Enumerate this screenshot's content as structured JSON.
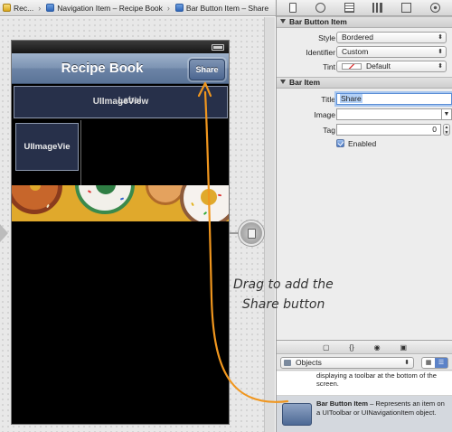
{
  "jumpbar": {
    "crumbs": [
      {
        "label": "Rec..."
      },
      {
        "label": "Navigation Item – Recipe Book"
      },
      {
        "label": "Bar Button Item – Share"
      }
    ]
  },
  "phone": {
    "nav_title": "Recipe Book",
    "share_label": "Share",
    "top_view_label_back": "UIImageView",
    "top_view_label_front": "Label",
    "thumb_view_label": "UIImageVie"
  },
  "inspector": {
    "bar_button_section": "Bar Button Item",
    "style_label": "Style",
    "style_value": "Bordered",
    "identifier_label": "Identifier",
    "identifier_value": "Custom",
    "tint_label": "Tint",
    "tint_value": "Default",
    "bar_item_section": "Bar Item",
    "title_label": "Title",
    "title_value": "Share",
    "image_label": "Image",
    "image_value": "",
    "tag_label": "Tag",
    "tag_value": "0",
    "enabled_label": "Enabled"
  },
  "library": {
    "filter_value": "Objects",
    "item1_desc": "displaying a toolbar at the bottom of the screen.",
    "item2_name": "Bar Button Item",
    "item2_desc": " – Represents an item on a UIToolbar or UINavigationItem object."
  },
  "annotation": {
    "line1": "Drag to add the",
    "line2": "Share button"
  },
  "colors": {
    "drag_arrow": "#f0961e",
    "nav_bar": "#6c84a6",
    "selection": "#b3d0f6"
  }
}
